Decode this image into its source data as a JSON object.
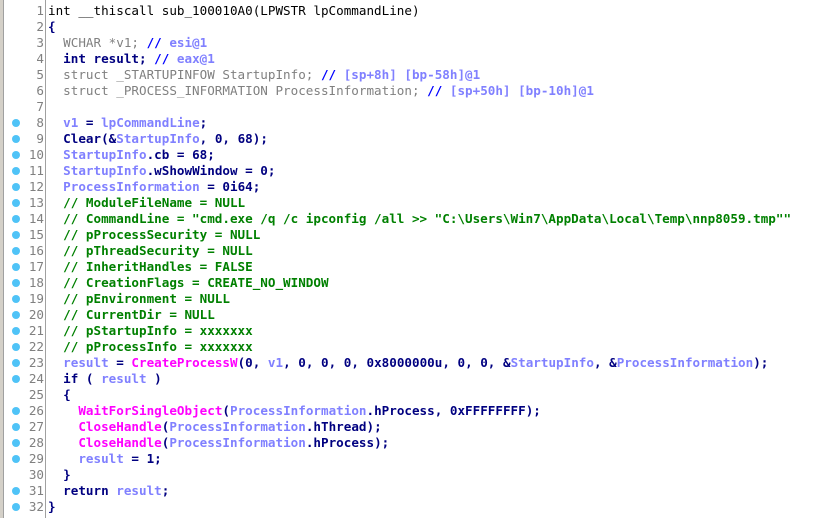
{
  "colors": {
    "default": "#000080",
    "variable": "#8080ff",
    "function": "#ff00ff",
    "comment": "#008000",
    "declaration": "#808080",
    "breakpoint": "#4fc3f7"
  },
  "lines": [
    {
      "n": "1",
      "bp": false,
      "t": [
        [
          "int __thiscall sub_100010A0(LPWSTR lpCommandLine)",
          "n"
        ]
      ]
    },
    {
      "n": "2",
      "bp": false,
      "t": [
        [
          "{",
          "d"
        ]
      ]
    },
    {
      "n": "3",
      "bp": false,
      "t": [
        [
          "  WCHAR *v1; ",
          "g"
        ],
        [
          "// ",
          "s"
        ],
        [
          "esi@1",
          "v"
        ]
      ]
    },
    {
      "n": "4",
      "bp": false,
      "t": [
        [
          "  int result; ",
          "d"
        ],
        [
          "// ",
          "s"
        ],
        [
          "eax@1",
          "v"
        ]
      ]
    },
    {
      "n": "5",
      "bp": false,
      "t": [
        [
          "  struct _STARTUPINFOW StartupInfo; ",
          "g"
        ],
        [
          "// ",
          "s"
        ],
        [
          "[sp+8h] [bp-58h]@1",
          "v"
        ]
      ]
    },
    {
      "n": "6",
      "bp": false,
      "t": [
        [
          "  struct _PROCESS_INFORMATION ProcessInformation; ",
          "g"
        ],
        [
          "// ",
          "s"
        ],
        [
          "[sp+50h] [bp-10h]@1",
          "v"
        ]
      ]
    },
    {
      "n": "7",
      "bp": false,
      "t": []
    },
    {
      "n": "8",
      "bp": true,
      "t": [
        [
          "  ",
          "d"
        ],
        [
          "v1",
          "v"
        ],
        [
          " = ",
          "d"
        ],
        [
          "lpCommandLine",
          "v"
        ],
        [
          ";",
          "d"
        ]
      ]
    },
    {
      "n": "9",
      "bp": true,
      "t": [
        [
          "  Clear(&",
          "d"
        ],
        [
          "StartupInfo",
          "v"
        ],
        [
          ", 0, 68);",
          "d"
        ]
      ]
    },
    {
      "n": "10",
      "bp": true,
      "t": [
        [
          "  ",
          "d"
        ],
        [
          "StartupInfo",
          "v"
        ],
        [
          ".cb = 68;",
          "d"
        ]
      ]
    },
    {
      "n": "11",
      "bp": true,
      "t": [
        [
          "  ",
          "d"
        ],
        [
          "StartupInfo",
          "v"
        ],
        [
          ".wShowWindow = 0;",
          "d"
        ]
      ]
    },
    {
      "n": "12",
      "bp": true,
      "t": [
        [
          "  ",
          "d"
        ],
        [
          "ProcessInformation",
          "v"
        ],
        [
          " = 0i64;",
          "d"
        ]
      ]
    },
    {
      "n": "13",
      "bp": true,
      "t": [
        [
          "  // ModuleFileName = NULL",
          "c"
        ]
      ]
    },
    {
      "n": "14",
      "bp": true,
      "t": [
        [
          "  // CommandLine = \"cmd.exe /q /c ipconfig /all >> \"C:\\Users\\Win7\\AppData\\Local\\Temp\\nnp8059.tmp\"\"",
          "c"
        ]
      ]
    },
    {
      "n": "15",
      "bp": true,
      "t": [
        [
          "  // pProcessSecurity = NULL",
          "c"
        ]
      ]
    },
    {
      "n": "16",
      "bp": true,
      "t": [
        [
          "  // pThreadSecurity = NULL",
          "c"
        ]
      ]
    },
    {
      "n": "17",
      "bp": true,
      "t": [
        [
          "  // InheritHandles = FALSE",
          "c"
        ]
      ]
    },
    {
      "n": "18",
      "bp": true,
      "t": [
        [
          "  // CreationFlags = CREATE_NO_WINDOW",
          "c"
        ]
      ]
    },
    {
      "n": "19",
      "bp": true,
      "t": [
        [
          "  // pEnvironment = NULL",
          "c"
        ]
      ]
    },
    {
      "n": "20",
      "bp": true,
      "t": [
        [
          "  // CurrentDir = NULL",
          "c"
        ]
      ]
    },
    {
      "n": "21",
      "bp": true,
      "t": [
        [
          "  // pStartupInfo = xxxxxxx",
          "c"
        ]
      ]
    },
    {
      "n": "22",
      "bp": true,
      "t": [
        [
          "  // pProcessInfo = xxxxxxx",
          "c"
        ]
      ]
    },
    {
      "n": "23",
      "bp": true,
      "t": [
        [
          "  ",
          "d"
        ],
        [
          "result",
          "v"
        ],
        [
          " = ",
          "d"
        ],
        [
          "CreateProcessW",
          "f"
        ],
        [
          "(0, ",
          "d"
        ],
        [
          "v1",
          "v"
        ],
        [
          ", 0, 0, 0, 0x8000000u, 0, 0, &",
          "d"
        ],
        [
          "StartupInfo",
          "v"
        ],
        [
          ", &",
          "d"
        ],
        [
          "ProcessInformation",
          "v"
        ],
        [
          ");",
          "d"
        ]
      ]
    },
    {
      "n": "24",
      "bp": true,
      "t": [
        [
          "  if ( ",
          "d"
        ],
        [
          "result",
          "v"
        ],
        [
          " )",
          "d"
        ]
      ]
    },
    {
      "n": "25",
      "bp": false,
      "t": [
        [
          "  {",
          "d"
        ]
      ]
    },
    {
      "n": "26",
      "bp": true,
      "t": [
        [
          "    ",
          "d"
        ],
        [
          "WaitForSingleObject",
          "f"
        ],
        [
          "(",
          "d"
        ],
        [
          "ProcessInformation",
          "v"
        ],
        [
          ".hProcess, 0xFFFFFFFF);",
          "d"
        ]
      ]
    },
    {
      "n": "27",
      "bp": true,
      "t": [
        [
          "    ",
          "d"
        ],
        [
          "CloseHandle",
          "f"
        ],
        [
          "(",
          "d"
        ],
        [
          "ProcessInformation",
          "v"
        ],
        [
          ".hThread);",
          "d"
        ]
      ]
    },
    {
      "n": "28",
      "bp": true,
      "t": [
        [
          "    ",
          "d"
        ],
        [
          "CloseHandle",
          "f"
        ],
        [
          "(",
          "d"
        ],
        [
          "ProcessInformation",
          "v"
        ],
        [
          ".hProcess);",
          "d"
        ]
      ]
    },
    {
      "n": "29",
      "bp": true,
      "t": [
        [
          "    ",
          "d"
        ],
        [
          "result",
          "v"
        ],
        [
          " = 1;",
          "d"
        ]
      ]
    },
    {
      "n": "30",
      "bp": false,
      "t": [
        [
          "  }",
          "d"
        ]
      ]
    },
    {
      "n": "31",
      "bp": true,
      "t": [
        [
          "  return ",
          "d"
        ],
        [
          "result",
          "v"
        ],
        [
          ";",
          "d"
        ]
      ]
    },
    {
      "n": "32",
      "bp": true,
      "t": [
        [
          "}",
          "d"
        ]
      ]
    }
  ]
}
